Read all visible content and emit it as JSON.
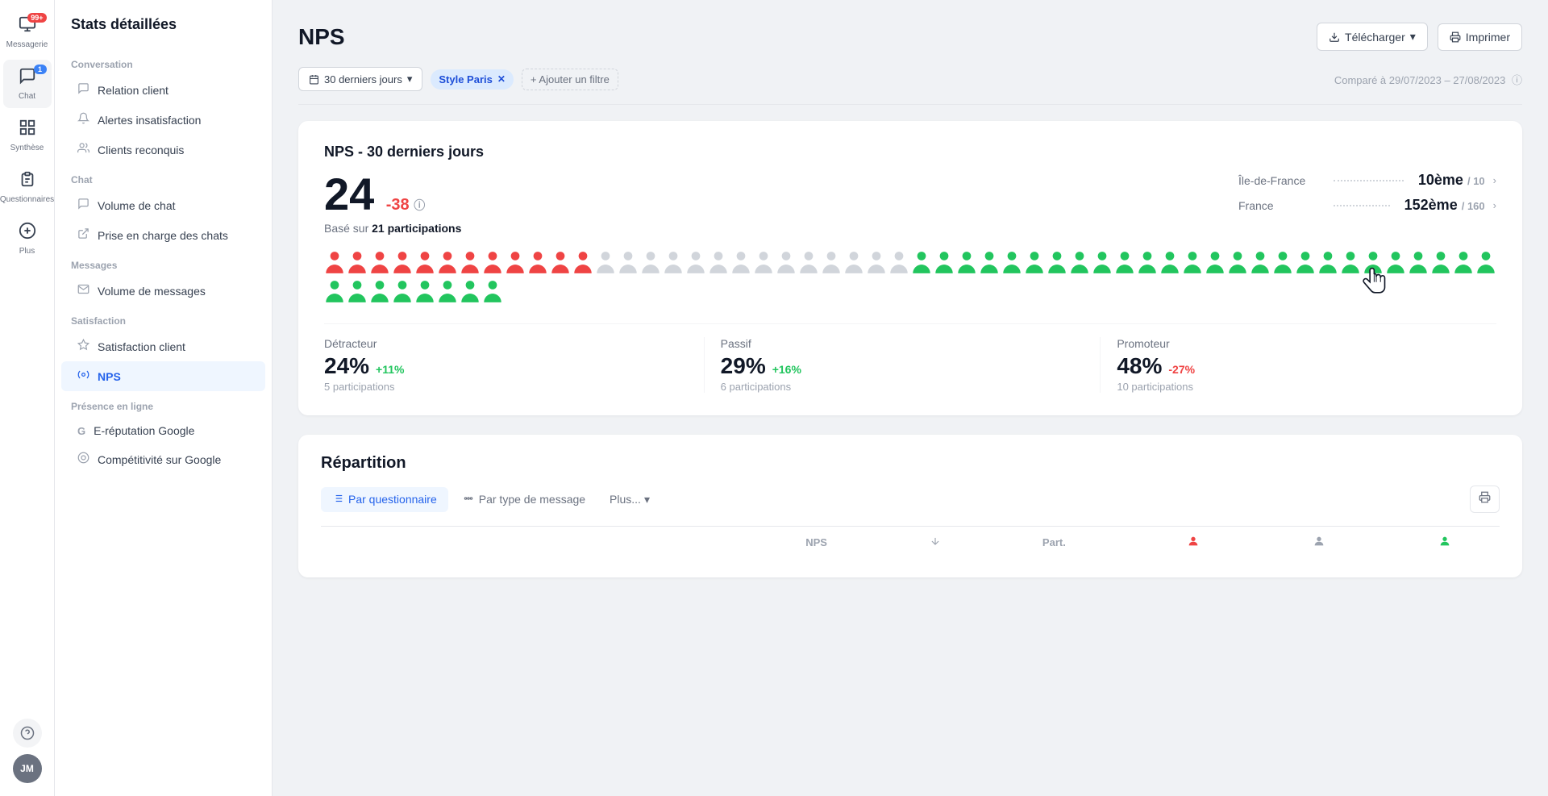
{
  "app": {
    "title": "Stats détaillées"
  },
  "icon_nav": {
    "items": [
      {
        "id": "messagerie",
        "label": "Messagerie",
        "icon": "💬",
        "badge": "99+",
        "badge_type": "red"
      },
      {
        "id": "chat",
        "label": "Chat",
        "icon": "🗨️",
        "badge": "1",
        "badge_type": "blue",
        "active": true
      },
      {
        "id": "synthese",
        "label": "Synthèse",
        "icon": "⊞",
        "badge": null
      },
      {
        "id": "questionnaires",
        "label": "Questionnaires",
        "icon": "📋",
        "badge": null
      },
      {
        "id": "plus",
        "label": "Plus",
        "icon": "⊕",
        "badge": null
      }
    ],
    "bottom": {
      "help_icon": "?",
      "avatar": "JM"
    }
  },
  "sidebar": {
    "title": "Stats détaillées",
    "sections": [
      {
        "label": "Conversation",
        "items": [
          {
            "id": "relation-client",
            "label": "Relation client",
            "icon": "💬"
          },
          {
            "id": "alertes-insatisfaction",
            "label": "Alertes insatisfaction",
            "icon": "🔔"
          },
          {
            "id": "clients-reconquis",
            "label": "Clients reconquis",
            "icon": "👥"
          }
        ]
      },
      {
        "label": "Chat",
        "items": [
          {
            "id": "volume-chat",
            "label": "Volume de chat",
            "icon": "💬"
          },
          {
            "id": "prise-en-charge",
            "label": "Prise en charge des chats",
            "icon": "↗️"
          }
        ]
      },
      {
        "label": "Messages",
        "items": [
          {
            "id": "volume-messages",
            "label": "Volume de messages",
            "icon": "✉️"
          }
        ]
      },
      {
        "label": "Satisfaction",
        "items": [
          {
            "id": "satisfaction-client",
            "label": "Satisfaction client",
            "icon": "☆"
          },
          {
            "id": "nps",
            "label": "NPS",
            "icon": "⚙️",
            "active": true
          }
        ]
      },
      {
        "label": "Présence en ligne",
        "items": [
          {
            "id": "e-reputation-google",
            "label": "E-réputation Google",
            "icon": "G"
          },
          {
            "id": "competitivite-google",
            "label": "Compétitivité sur Google",
            "icon": "⊙"
          }
        ]
      }
    ]
  },
  "page": {
    "title": "NPS",
    "actions": {
      "download": "Télécharger",
      "print": "Imprimer"
    },
    "filters": {
      "date_label": "30 derniers jours",
      "tag_label": "Style Paris",
      "add_filter": "+ Ajouter un filtre",
      "compare_text": "Comparé à 29/07/2023 – 27/08/2023"
    },
    "nps_card": {
      "title": "NPS - 30 derniers jours",
      "score": "24",
      "score_change": "-38",
      "participations_label": "Basé sur",
      "participations_count": "21 participations",
      "rankings": [
        {
          "region": "Île-de-France",
          "rank": "10ème",
          "total": "10"
        },
        {
          "region": "France",
          "rank": "152ème",
          "total": "160"
        }
      ],
      "stats": [
        {
          "label": "Détracteur",
          "value": "24%",
          "change": "+11%",
          "change_type": "pos",
          "participations": "5 participations"
        },
        {
          "label": "Passif",
          "value": "29%",
          "change": "+16%",
          "change_type": "pos",
          "participations": "6 participations"
        },
        {
          "label": "Promoteur",
          "value": "48%",
          "change": "-27%",
          "change_type": "neg",
          "participations": "10 participations"
        }
      ],
      "people": {
        "red_count": 12,
        "gray_count": 14,
        "green_count": 34
      }
    },
    "repartition": {
      "title": "Répartition",
      "tabs": [
        {
          "id": "par-questionnaire",
          "label": "Par questionnaire",
          "icon": "≡",
          "active": true
        },
        {
          "id": "par-type-message",
          "label": "Par type de message",
          "icon": "⬡"
        },
        {
          "id": "plus",
          "label": "Plus...",
          "icon": ""
        }
      ],
      "table_headers": [
        "NPS",
        "Part.",
        "🔴",
        "⬡",
        "🟢"
      ]
    }
  }
}
